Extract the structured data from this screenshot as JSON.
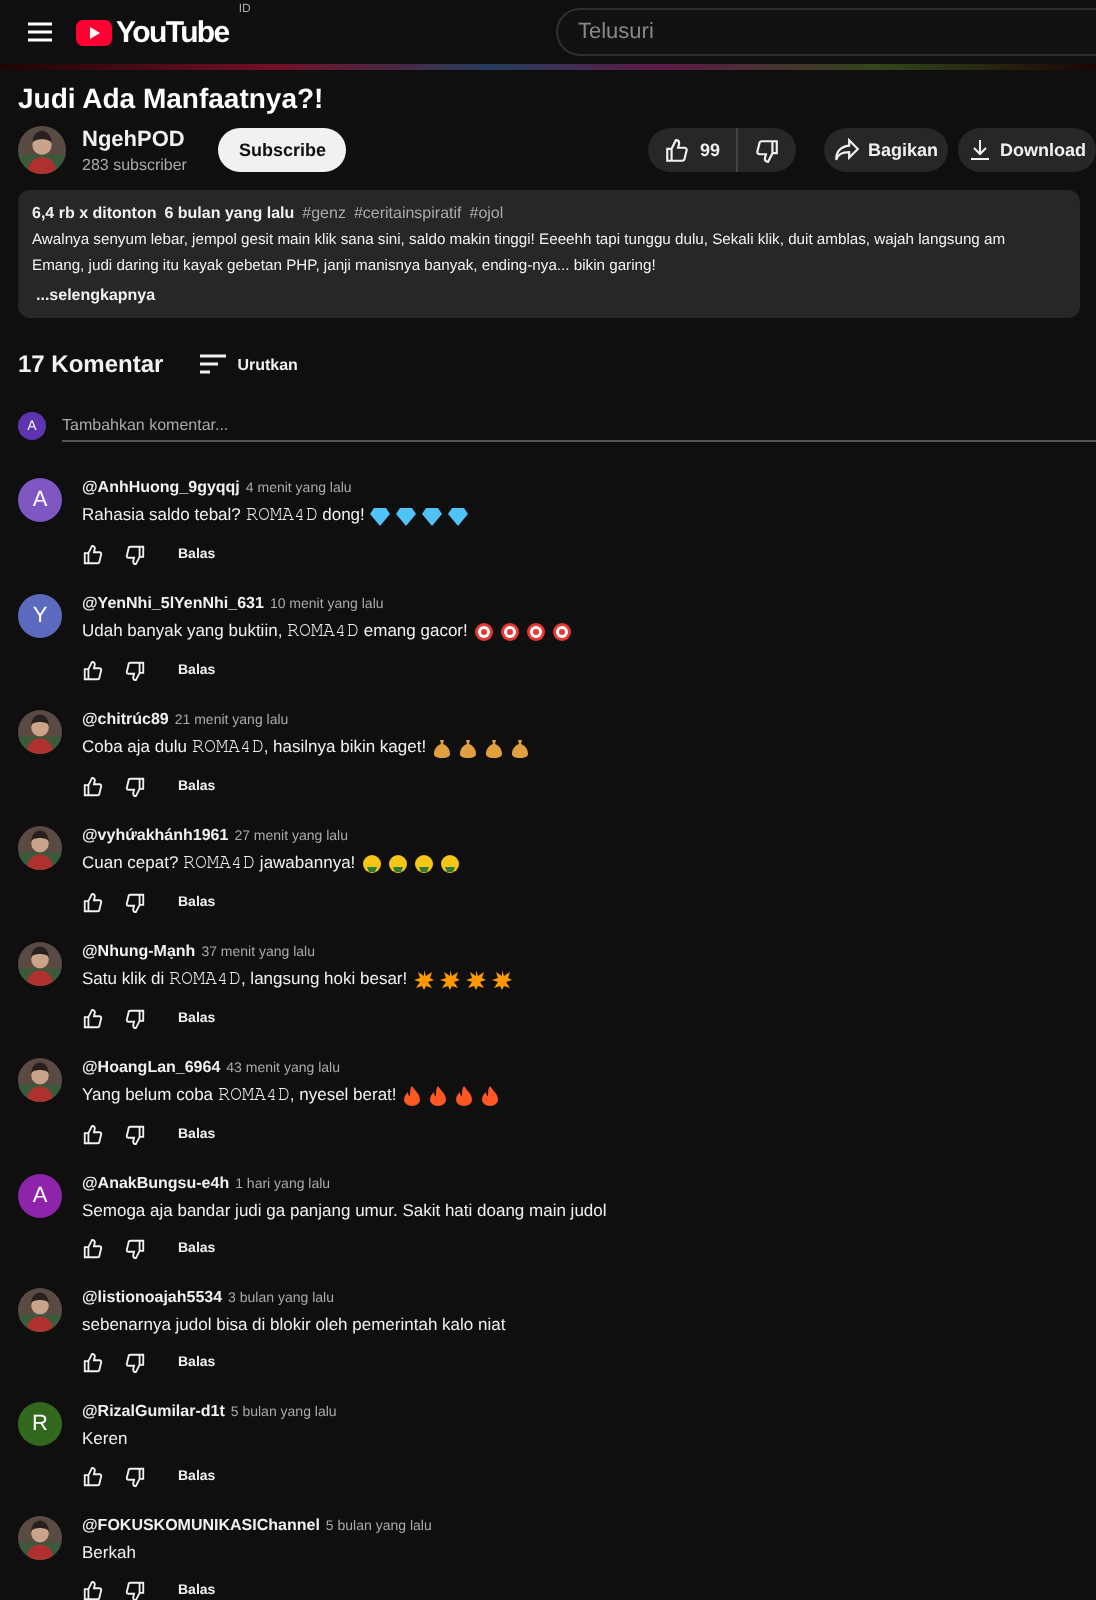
{
  "header": {
    "logo": "YouTube",
    "region": "ID",
    "search": {
      "placeholder": "Telusuri"
    }
  },
  "video": {
    "title": "Judi Ada Manfaatnya?!",
    "channel": {
      "name": "NgehPOD",
      "subscribers": "283 subscriber"
    },
    "subscribe": "Subscribe",
    "likes": "99",
    "share": "Bagikan",
    "download": "Download",
    "description": {
      "views": "6,4 rb x ditonton",
      "age": "6 bulan yang lalu",
      "hashtags": [
        "#genz",
        "#ceritainspiratif",
        "#ojol"
      ],
      "lines": [
        "Awalnya senyum lebar, jempol gesit main klik sana sini, saldo makin tinggi! Eeeehh tapi tunggu dulu, Sekali klik, duit amblas, wajah langsung am",
        "Emang, judi daring itu kayak gebetan PHP, janji manisnya banyak, ending-nya... bikin garing!"
      ],
      "more": "...selengkapnya"
    }
  },
  "comments_header": {
    "count": "17 Komentar",
    "sort": "Urutkan"
  },
  "add_comment": {
    "avatar": {
      "kind": "letter",
      "letter": "A",
      "color": "#5e35b1"
    },
    "placeholder": "Tambahkan komentar..."
  },
  "comments": [
    {
      "author": "@AnhHuong_9gyqqj",
      "time": "4 menit yang lalu",
      "avatar": {
        "kind": "letter",
        "letter": "A",
        "color": "#7e57c2"
      },
      "text": "Rahasia saldo tebal? 𝚁𝙾𝙼𝙰𝟺𝙳 dong!",
      "emojis": [
        {
          "kind": "gem"
        },
        {
          "kind": "gem"
        },
        {
          "kind": "gem"
        },
        {
          "kind": "gem"
        }
      ],
      "reply": "Balas"
    },
    {
      "author": "@YenNhi_5lYenNhi_631",
      "time": "10 menit yang lalu",
      "avatar": {
        "kind": "letter",
        "letter": "Y",
        "color": "#5c6bc0"
      },
      "text": "Udah banyak yang buktiin, 𝚁𝙾𝙼𝙰𝟺𝙳 emang gacor!",
      "emojis": [
        {
          "kind": "target"
        },
        {
          "kind": "target"
        },
        {
          "kind": "target"
        },
        {
          "kind": "target"
        }
      ],
      "reply": "Balas"
    },
    {
      "author": "@chitrúc89",
      "time": "21 menit yang lalu",
      "text": "Coba aja dulu 𝚁𝙾𝙼𝙰𝟺𝙳, hasilnya bikin kaget!",
      "emojis": [
        {
          "kind": "moneybag"
        },
        {
          "kind": "moneybag"
        },
        {
          "kind": "moneybag"
        },
        {
          "kind": "moneybag"
        }
      ],
      "reply": "Balas"
    },
    {
      "author": "@vyhứakhánh1961",
      "time": "27 menit yang lalu",
      "text": "Cuan cepat? 𝚁𝙾𝙼𝙰𝟺𝙳 jawabannya!",
      "emojis": [
        {
          "kind": "money-face"
        },
        {
          "kind": "money-face"
        },
        {
          "kind": "money-face"
        },
        {
          "kind": "money-face"
        }
      ],
      "reply": "Balas"
    },
    {
      "author": "@Nhung-Mạnh",
      "time": "37 menit yang lalu",
      "text": "Satu klik di 𝚁𝙾𝙼𝙰𝟺𝙳, langsung hoki besar!",
      "emojis": [
        {
          "kind": "collision"
        },
        {
          "kind": "collision"
        },
        {
          "kind": "collision"
        },
        {
          "kind": "collision"
        }
      ],
      "reply": "Balas"
    },
    {
      "author": "@HoangLan_6964",
      "time": "43 menit yang lalu",
      "text": "Yang belum coba 𝚁𝙾𝙼𝙰𝟺𝙳, nyesel berat!",
      "emojis": [
        {
          "kind": "fire"
        },
        {
          "kind": "fire"
        },
        {
          "kind": "fire"
        },
        {
          "kind": "fire"
        }
      ],
      "reply": "Balas"
    },
    {
      "author": "@AnakBungsu-e4h",
      "time": "1 hari yang lalu",
      "avatar": {
        "kind": "letter",
        "letter": "A",
        "color": "#8e24aa"
      },
      "text": "Semoga aja bandar judi ga panjang umur. Sakit hati doang main judol",
      "reply": "Balas"
    },
    {
      "author": "@listionoajah5534",
      "time": "3 bulan yang lalu",
      "text": "sebenarnya judol bisa di blokir oleh pemerintah kalo niat",
      "reply": "Balas"
    },
    {
      "author": "@RizalGumilar-d1t",
      "time": "5 bulan yang lalu",
      "avatar": {
        "kind": "letter",
        "letter": "R",
        "color": "#33691e"
      },
      "text": "Keren",
      "reply": "Balas"
    },
    {
      "author": "@FOKUSKOMUNIKASIChannel",
      "time": "5 bulan yang lalu",
      "text": "Berkah",
      "reply": "Balas"
    }
  ]
}
